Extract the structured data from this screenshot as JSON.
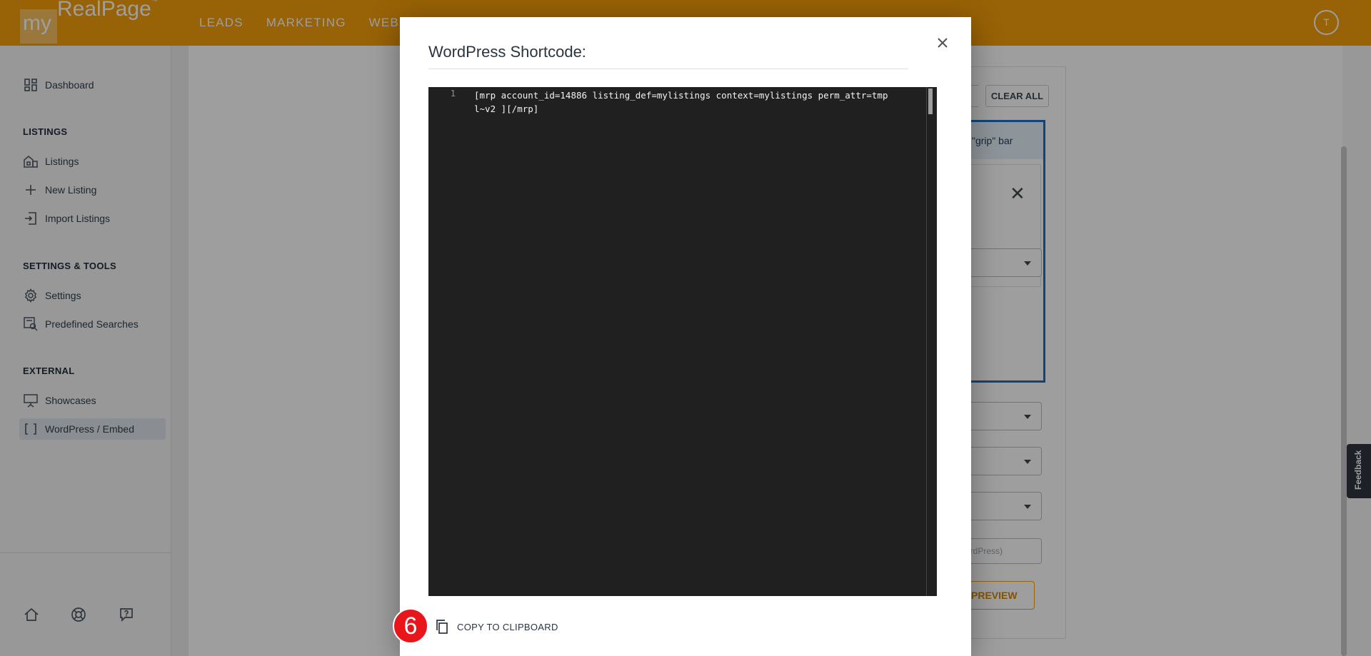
{
  "app": {
    "logo_my": "my",
    "logo_name": "RealPage",
    "logo_tm": "™",
    "topnav": [
      "LEADS",
      "MARKETING",
      "WEBS"
    ],
    "avatar_initial": "T"
  },
  "sidebar": {
    "items": [
      {
        "label": "Dashboard",
        "icon": "dashboard-icon"
      },
      {
        "label": "Listings",
        "icon": "building-icon"
      },
      {
        "label": "New Listing",
        "icon": "plus-icon"
      },
      {
        "label": "Import Listings",
        "icon": "import-icon"
      },
      {
        "label": "Settings",
        "icon": "gear-icon"
      },
      {
        "label": "Predefined Searches",
        "icon": "saved-search-icon"
      },
      {
        "label": "Showcases",
        "icon": "easel-icon"
      },
      {
        "label": "WordPress / Embed",
        "icon": "brackets-icon"
      }
    ],
    "sections": [
      "LISTINGS",
      "SETTINGS & TOOLS",
      "EXTERNAL"
    ]
  },
  "background": {
    "clear_all": "CLEAR ALL",
    "grip_text": "\"grip\" bar",
    "wp_placeholder": "ordPress)",
    "preview": "PREVIEW",
    "feedback": "Feedback"
  },
  "modal": {
    "title": "WordPress Shortcode:",
    "line_number": "1",
    "code": "[mrp account_id=14886 listing_def=mylistings context=mylistings perm_attr=tmpl~v2 ][/mrp]",
    "copy_label": "COPY TO CLIPBOARD",
    "step_badge": "6"
  },
  "colors": {
    "brand": "#f59e0b",
    "accent_blue": "#1e6fc2",
    "editor_bg": "#202020",
    "badge_red": "#e8151b"
  }
}
